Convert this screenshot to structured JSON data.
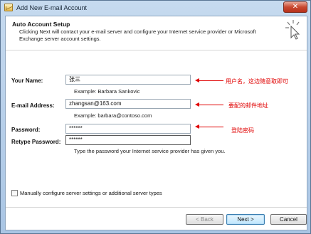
{
  "window": {
    "title": "Add New E-mail Account",
    "close_label": "✕"
  },
  "header": {
    "title": "Auto Account Setup",
    "description": "Clicking Next will contact your e-mail server and configure your Internet service provider or Microsoft Exchange server account settings."
  },
  "form": {
    "name_label": "Your Name:",
    "name_value": "张三",
    "name_hint": "Example: Barbara Sankovic",
    "email_label": "E-mail Address:",
    "email_value": "zhangsan@163.com",
    "email_hint": "Example: barbara@contoso.com",
    "password_label": "Password:",
    "password_value": "******",
    "retype_label": "Retype Password:",
    "retype_value": "******",
    "password_hint": "Type the password your Internet service provider has given you."
  },
  "annotations": {
    "name_note": "用户名，这边随意取即可",
    "email_note": "要配的邮件地址",
    "password_note": "登陆密码",
    "color": "#e00000"
  },
  "manual_config": {
    "label": "Manually configure server settings or additional server types",
    "checked": false
  },
  "buttons": {
    "back": "< Back",
    "next": "Next >",
    "cancel": "Cancel"
  }
}
